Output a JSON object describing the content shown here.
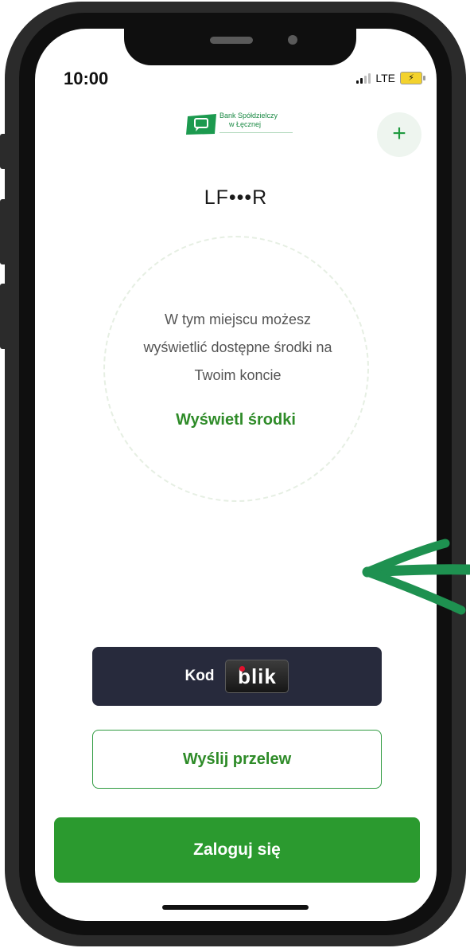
{
  "status_bar": {
    "time": "10:00",
    "network": "LTE"
  },
  "header": {
    "logo_text_line1": "Bank Spółdzielczy",
    "logo_text_line2": "w Łęcznej",
    "add_button_label": "+"
  },
  "account": {
    "masked_name": "LF•••R"
  },
  "balance_panel": {
    "info_line1": "W tym miejscu możesz",
    "info_line2": "wyświetlić dostępne środki na",
    "info_line3": "Twoim koncie",
    "show_funds_label": "Wyświetl środki"
  },
  "actions": {
    "blik_label": "Kod",
    "blik_logo_text": "blik",
    "transfer_label": "Wyślij przelew",
    "login_label": "Zaloguj się"
  },
  "colors": {
    "brand_green": "#2b9a2f",
    "text_green": "#2e8b28",
    "blik_dark": "#272a3c",
    "annotation_arrow": "#1e9150"
  },
  "icons": {
    "add": "plus-icon",
    "signal": "signal-icon",
    "battery": "battery-charging-icon",
    "annotation": "arrow-left-icon"
  }
}
